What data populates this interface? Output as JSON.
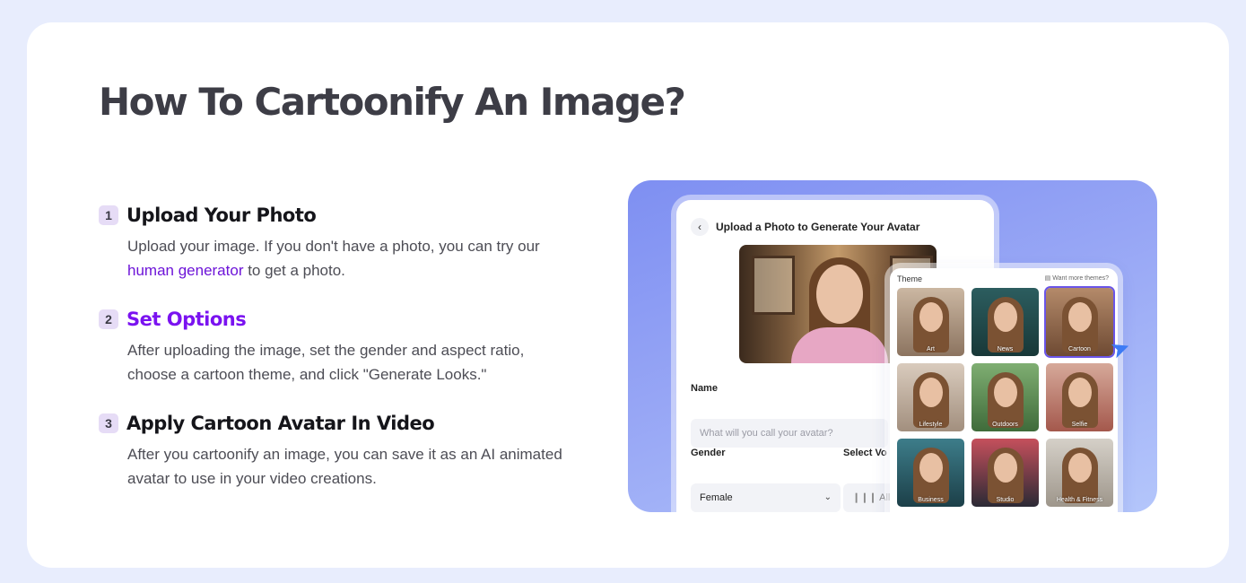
{
  "title": "How To Cartoonify An Image?",
  "steps": [
    {
      "num": "1",
      "title": "Upload Your Photo",
      "desc_pre": "Upload your image. If you don't have a photo, you can try our ",
      "desc_link": "human generator",
      "desc_post": " to get a photo."
    },
    {
      "num": "2",
      "title": "Set Options",
      "desc": "After uploading the image, set the gender and aspect ratio, choose a cartoon theme, and click \"Generate Looks.\""
    },
    {
      "num": "3",
      "title": "Apply Cartoon Avatar In Video",
      "desc": "After you cartoonify an image, you can save it as an AI animated avatar to use in your video creations."
    }
  ],
  "colors": {
    "accent": "#7a12f0",
    "link": "#6d14d8",
    "page_bg": "#e8edfd"
  },
  "mockup": {
    "panel_title": "Upload a Photo to Generate Your Avatar",
    "name_label": "Name",
    "name_placeholder": "What will you call your avatar?",
    "gender_label": "Gender",
    "gender_value": "Female",
    "voice_label": "Select Vo",
    "voice_value": "Allis",
    "theme_label": "Theme",
    "more_themes": "Want more themes?",
    "themes": [
      "Art",
      "News",
      "Cartoon",
      "Lifestyle",
      "Outdoors",
      "Selfie",
      "Business",
      "Studio",
      "Health & Fitness"
    ],
    "selected_theme": "Cartoon"
  }
}
